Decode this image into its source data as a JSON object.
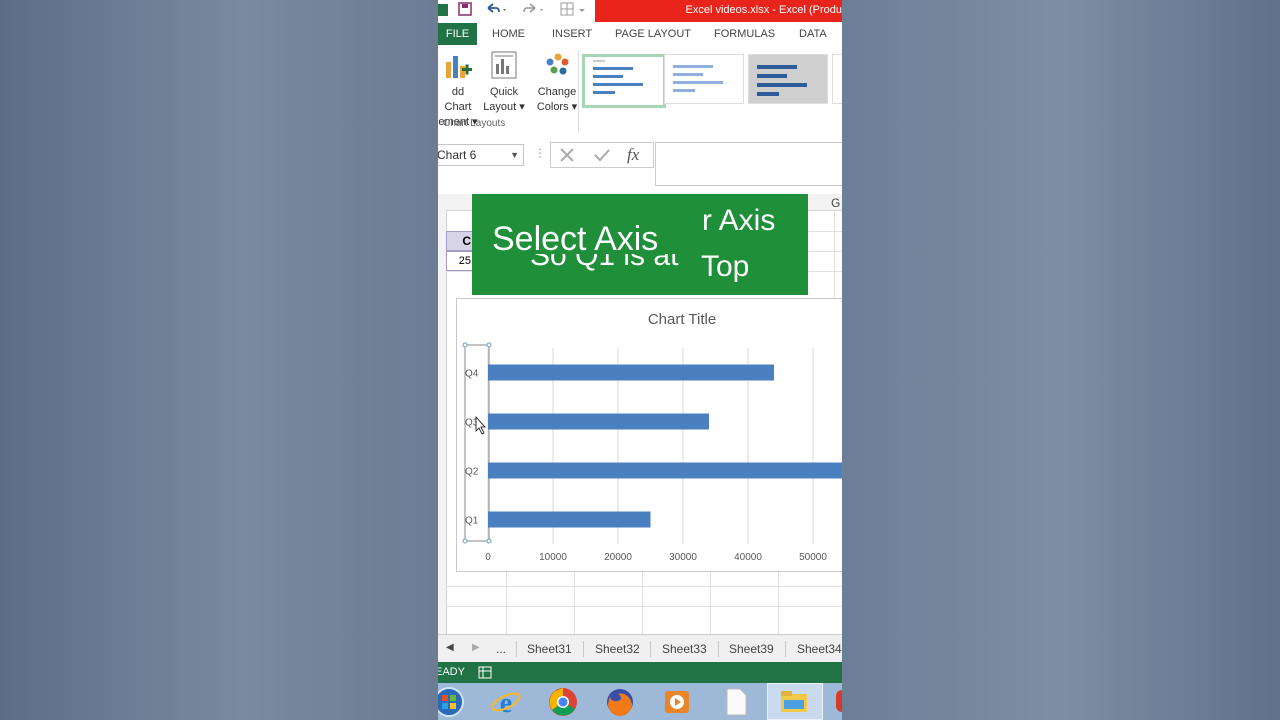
{
  "titlebar": {
    "title": "Excel videos.xlsx -  Excel (Produ"
  },
  "tabs": {
    "file": "FILE",
    "items": [
      "HOME",
      "INSERT",
      "PAGE LAYOUT",
      "FORMULAS",
      "DATA"
    ]
  },
  "ribbon": {
    "add_chart_line1": "dd Chart",
    "add_chart_line2": "ement",
    "quick_layout_line1": "Quick",
    "quick_layout_line2": "Layout",
    "change_colors_line1": "Change",
    "change_colors_line2": "Colors",
    "group_label": "Chart Layouts"
  },
  "formula_bar": {
    "name_box": "Chart 6",
    "fx": "fx"
  },
  "sheet": {
    "col_g": "G",
    "cell_c": "C",
    "cell_value": "25"
  },
  "banner": {
    "line_a": "Select Axis",
    "line_b": "r Axis",
    "line_c": "Top",
    "line_d": "So Q1 is at"
  },
  "chart_data": {
    "type": "bar",
    "title": "Chart Title",
    "categories": [
      "Q1",
      "Q2",
      "Q3",
      "Q4"
    ],
    "values": [
      25000,
      55000,
      34000,
      44000
    ],
    "x_ticks": [
      "0",
      "10000",
      "20000",
      "30000",
      "40000",
      "50000"
    ],
    "xlim": [
      0,
      60000
    ],
    "color": "#4a7fc0",
    "orientation": "horizontal"
  },
  "sheet_tabs": {
    "ellipsis": "...",
    "items": [
      "Sheet31",
      "Sheet32",
      "Sheet33",
      "Sheet39",
      "Sheet34"
    ]
  },
  "status": {
    "text": "EADY"
  },
  "colors": {
    "excel_green": "#217346",
    "banner_green": "#1f8f3a",
    "title_red": "#e8241b"
  },
  "taskbar": {
    "icons": [
      "start-icon",
      "internet-explorer-icon",
      "chrome-icon",
      "firefox-icon",
      "media-player-icon",
      "document-icon",
      "file-explorer-icon"
    ]
  }
}
